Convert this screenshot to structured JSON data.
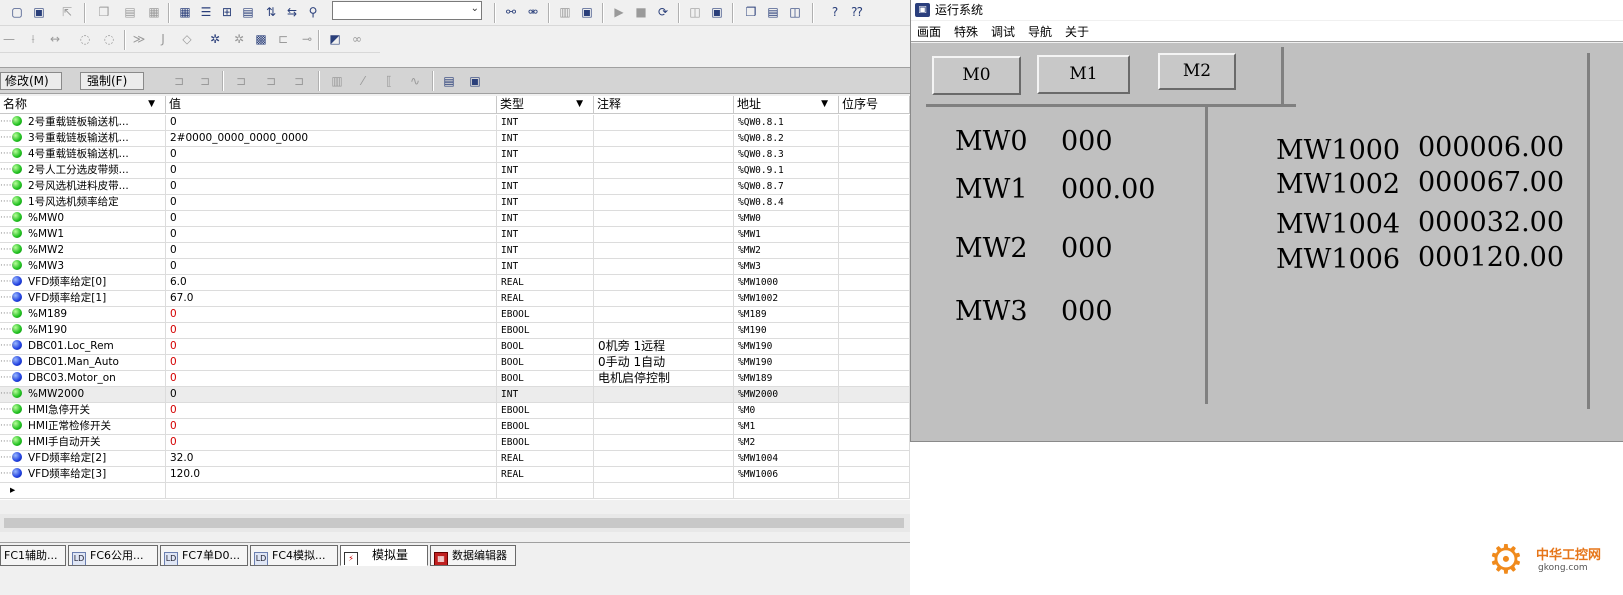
{
  "toolbar1": {
    "combo_value": ""
  },
  "mode_buttons": {
    "modify": "修改(M)",
    "force": "强制(F)"
  },
  "columns": {
    "name": "名称",
    "value": "值",
    "type": "类型",
    "comment": "注释",
    "address": "地址",
    "bit_index": "位序号"
  },
  "rows": [
    {
      "name": "2号重载链板输送机...",
      "value": "0",
      "type": "INT",
      "comment": "",
      "address": "%QW0.8.1",
      "dot": "green",
      "red": false
    },
    {
      "name": "3号重载链板输送机...",
      "value": "2#0000_0000_0000_0000",
      "type": "INT",
      "comment": "",
      "address": "%QW0.8.2",
      "dot": "green",
      "red": false
    },
    {
      "name": "4号重载链板输送机...",
      "value": "0",
      "type": "INT",
      "comment": "",
      "address": "%QW0.8.3",
      "dot": "green",
      "red": false
    },
    {
      "name": "2号人工分选皮带频...",
      "value": "0",
      "type": "INT",
      "comment": "",
      "address": "%QW0.9.1",
      "dot": "green",
      "red": false
    },
    {
      "name": "2号风选机进料皮带...",
      "value": "0",
      "type": "INT",
      "comment": "",
      "address": "%QW0.8.7",
      "dot": "green",
      "red": false
    },
    {
      "name": "1号风选机频率给定",
      "value": "0",
      "type": "INT",
      "comment": "",
      "address": "%QW0.8.4",
      "dot": "green",
      "red": false
    },
    {
      "name": "%MW0",
      "value": "0",
      "type": "INT",
      "comment": "",
      "address": "%MW0",
      "dot": "green",
      "red": false
    },
    {
      "name": "%MW1",
      "value": "0",
      "type": "INT",
      "comment": "",
      "address": "%MW1",
      "dot": "green",
      "red": false
    },
    {
      "name": "%MW2",
      "value": "0",
      "type": "INT",
      "comment": "",
      "address": "%MW2",
      "dot": "green",
      "red": false
    },
    {
      "name": "%MW3",
      "value": "0",
      "type": "INT",
      "comment": "",
      "address": "%MW3",
      "dot": "green",
      "red": false
    },
    {
      "name": "VFD频率给定[0]",
      "value": "6.0",
      "type": "REAL",
      "comment": "",
      "address": "%MW1000",
      "dot": "blue",
      "red": false
    },
    {
      "name": "VFD频率给定[1]",
      "value": "67.0",
      "type": "REAL",
      "comment": "",
      "address": "%MW1002",
      "dot": "blue",
      "red": false
    },
    {
      "name": "%M189",
      "value": "0",
      "type": "EBOOL",
      "comment": "",
      "address": "%M189",
      "dot": "green",
      "red": true
    },
    {
      "name": "%M190",
      "value": "0",
      "type": "EBOOL",
      "comment": "",
      "address": "%M190",
      "dot": "green",
      "red": true
    },
    {
      "name": "DBC01.Loc_Rem",
      "value": "0",
      "type": "BOOL",
      "comment": "0机旁 1远程",
      "address": "%MW190",
      "dot": "blue",
      "red": true
    },
    {
      "name": "DBC01.Man_Auto",
      "value": "0",
      "type": "BOOL",
      "comment": "0手动 1自动",
      "address": "%MW190",
      "dot": "blue",
      "red": true
    },
    {
      "name": "DBC03.Motor_on",
      "value": "0",
      "type": "BOOL",
      "comment": "电机启停控制",
      "address": "%MW189",
      "dot": "blue",
      "red": true
    },
    {
      "name": "%MW2000",
      "value": "0",
      "type": "INT",
      "comment": "",
      "address": "%MW2000",
      "dot": "green",
      "red": false
    },
    {
      "name": "HMI急停开关",
      "value": "0",
      "type": "EBOOL",
      "comment": "",
      "address": "%M0",
      "dot": "green",
      "red": true
    },
    {
      "name": "HMI正常检修开关",
      "value": "0",
      "type": "EBOOL",
      "comment": "",
      "address": "%M1",
      "dot": "green",
      "red": true
    },
    {
      "name": "HMI手自动开关",
      "value": "0",
      "type": "EBOOL",
      "comment": "",
      "address": "%M2",
      "dot": "green",
      "red": true
    },
    {
      "name": "VFD频率给定[2]",
      "value": "32.0",
      "type": "REAL",
      "comment": "",
      "address": "%MW1004",
      "dot": "blue",
      "red": false
    },
    {
      "name": "VFD频率给定[3]",
      "value": "120.0",
      "type": "REAL",
      "comment": "",
      "address": "%MW1006",
      "dot": "blue",
      "red": false
    }
  ],
  "new_row_marker": "▸",
  "tabs": [
    "FC1辅助...",
    "FC6公用...",
    "FC7单D0...",
    "FC4模拟...",
    "模拟量",
    "数据编辑器"
  ],
  "runtime": {
    "title": "运行系统",
    "menu": [
      "画面",
      "特殊",
      "调试",
      "导航",
      "关于"
    ],
    "buttons": [
      "M0",
      "M1",
      "M2"
    ],
    "left_values": [
      {
        "label": "MW0",
        "value": "000"
      },
      {
        "label": "MW1",
        "value": "000.00"
      },
      {
        "label": "MW2",
        "value": "000"
      },
      {
        "label": "MW3",
        "value": "000"
      }
    ],
    "right_values": [
      {
        "label": "MW1000",
        "value": "000006.00"
      },
      {
        "label": "MW1002",
        "value": "000067.00"
      },
      {
        "label": "MW1004",
        "value": "000032.00"
      },
      {
        "label": "MW1006",
        "value": "000120.00"
      }
    ]
  },
  "watermark": {
    "name": "中华工控网",
    "url": "gkong.com"
  },
  "colors": {
    "dot_green": "#1fbf1f",
    "dot_blue": "#1f3fdf",
    "red_value": "#d40000",
    "runtime_bg": "#c0c0c0",
    "watermark": "#f08a1c"
  }
}
